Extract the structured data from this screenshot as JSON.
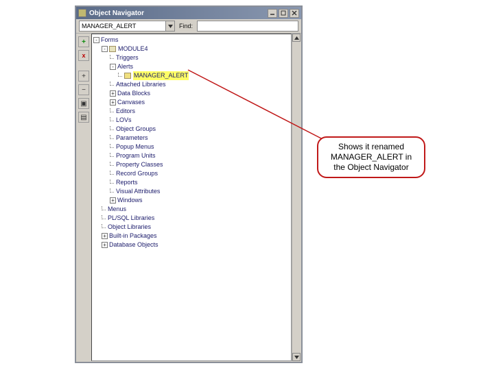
{
  "titlebar": {
    "title": "Object Navigator"
  },
  "toolbar": {
    "combo_value": "MANAGER_ALERT",
    "find_label": "Find:",
    "find_value": ""
  },
  "side_buttons": {
    "add": "+",
    "delete": "x",
    "expand": "+",
    "collapse": "−",
    "b1": "▣",
    "b2": "▤"
  },
  "tree": {
    "root": "Forms",
    "module": "MODULE4",
    "items": [
      "Triggers",
      "Alerts"
    ],
    "alert_item": "MANAGER_ALERT",
    "items2": [
      "Attached Libraries",
      "Data Blocks",
      "Canvases",
      "Editors",
      "LOVs",
      "Object Groups",
      "Parameters",
      "Popup Menus",
      "Program Units",
      "Property Classes",
      "Record Groups",
      "Reports",
      "Visual Attributes",
      "Windows"
    ],
    "siblings": [
      "Menus",
      "PL/SQL Libraries",
      "Object Libraries",
      "Built-in Packages",
      "Database Objects"
    ]
  },
  "callout": {
    "line1": "Shows it renamed",
    "line2": "MANAGER_ALERT in",
    "line3": "the Object Navigator"
  }
}
